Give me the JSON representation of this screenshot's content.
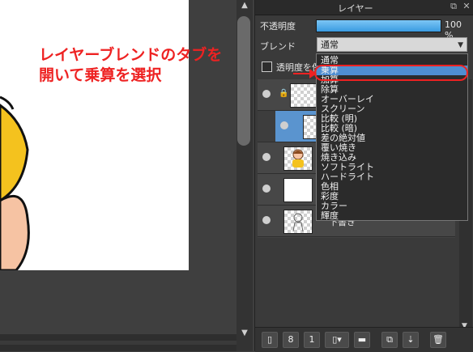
{
  "panel": {
    "title": "レイヤー",
    "opacity_label": "不透明度",
    "opacity_value": "100 %",
    "opacity_percent": 100,
    "blend_label": "ブレンド",
    "blend_selected": "通常",
    "clip_checkbox_label": "透明度を保護",
    "layers": [
      {
        "name": ""
      },
      {
        "name": ""
      },
      {
        "name": ""
      },
      {
        "name": ""
      },
      {
        "name": "下書き"
      }
    ]
  },
  "dropdown": {
    "options": [
      "通常",
      "乗算",
      "加算",
      "除算",
      "オーバーレイ",
      "スクリーン",
      "比較 (明)",
      "比較 (暗)",
      "差の絶対値",
      "覆い焼き",
      "焼き込み",
      "ソフトライト",
      "ハードライト",
      "色相",
      "彩度",
      "カラー",
      "輝度"
    ],
    "highlighted": "乗算"
  },
  "annotation": {
    "line1": "レイヤーブレンドのタブを",
    "line2": "開いて乗算を選択"
  },
  "toolbar": {
    "buttons": [
      "new-layer",
      "new-8bit-layer",
      "new-1bit-layer",
      "add-layer-menu",
      "new-folder",
      "duplicate-layer",
      "merge-layer",
      "delete-layer"
    ]
  },
  "colors": {
    "accent": "#4f8ed1",
    "annotation": "#ee2222",
    "selected_layer": "#5a94cf"
  }
}
